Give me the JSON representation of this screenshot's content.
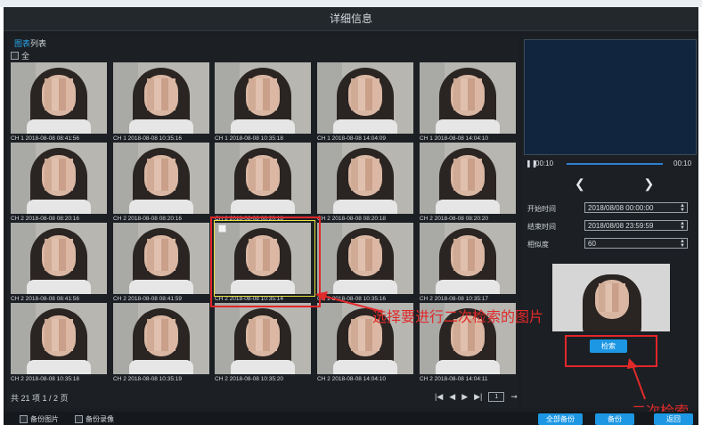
{
  "window": {
    "title": "详细信息"
  },
  "left": {
    "tabs": [
      "图表",
      "列表"
    ],
    "select_all_label": "全",
    "thumbnails": [
      "CH 1 2018-08-08 08:41:56",
      "CH 1 2018-08-08 10:35:16",
      "CH 1 2018-08-08 10:35:18",
      "CH 1 2018-08-08 14:04:09",
      "CH 1 2018-08-08 14:04:10",
      "CH 2 2018-08-08 08:20:16",
      "CH 2 2018-08-08 08:20:16",
      "CH 2 2018-08-08 08:20:18",
      "CH 2 2018-08-08 08:20:18",
      "CH 2 2018-08-08 08:20:20",
      "CH 2 2018-08-08 08:41:56",
      "CH 2 2018-08-08 08:41:59",
      "CH 2 2018-08-08 10:35:14",
      "CH 2 2018-08-08 10:35:16",
      "CH 2 2018-08-08 10:35:17",
      "CH 2 2018-08-08 10:35:18",
      "CH 2 2018-08-08 10:35:19",
      "CH 2 2018-08-08 10:35:20",
      "CH 2 2018-08-08 14:04:10",
      "CH 2 2018-08-08 14:04:11"
    ],
    "pager_info": "共 21 项 1 / 2 页",
    "page_input_value": "1"
  },
  "right": {
    "time_start": "00:10",
    "time_end": "00:10",
    "start_label": "开始时间",
    "start_value": "2018/08/08 00:00:00",
    "end_label": "结束时间",
    "end_value": "2018/08/08 23:59:59",
    "similarity_label": "相似度",
    "similarity_value": "60",
    "search_button": "检索"
  },
  "annotations": {
    "select_note": "选择要进行二次检索的图片",
    "search_note": "二次检索"
  },
  "bottom": {
    "backup_images": "备份图片",
    "backup_video": "备份录像",
    "backup_all": "全部备份",
    "backup": "备份",
    "back": "返回"
  },
  "colors": {
    "accent": "#1d97e3",
    "annotation": "#e02a2a",
    "selection_border": "#e6e03b"
  }
}
